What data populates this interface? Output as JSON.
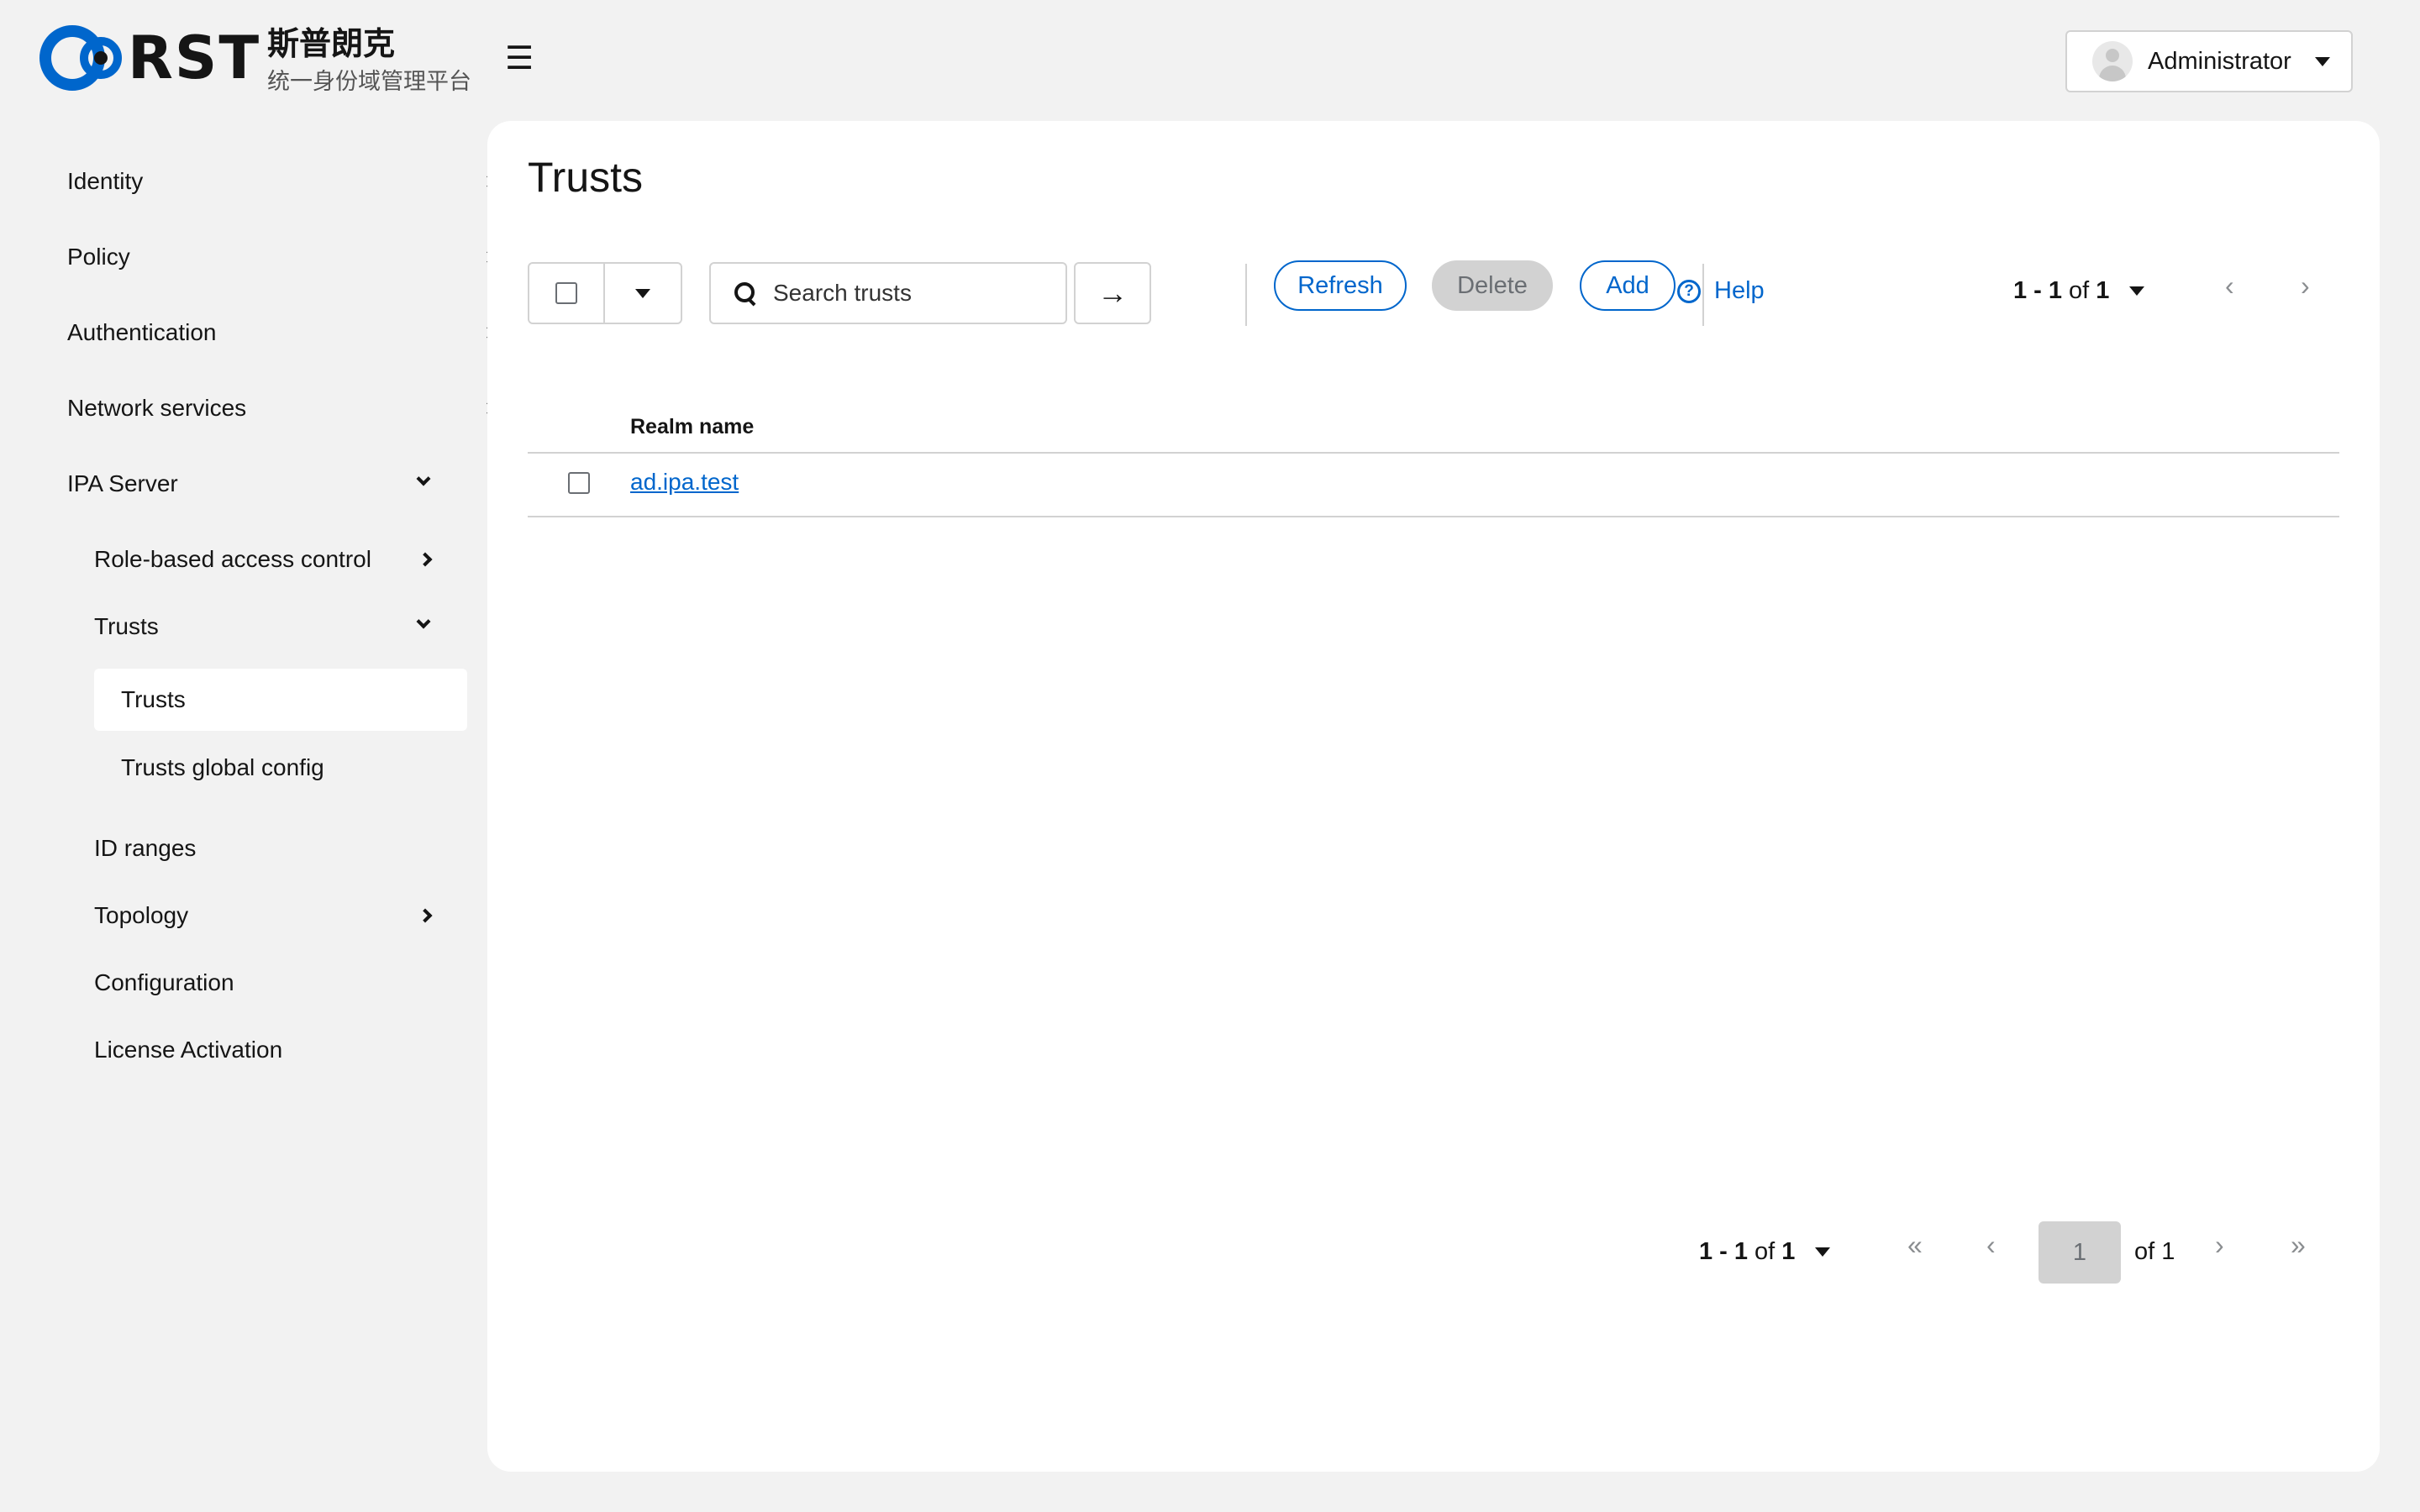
{
  "brand": {
    "logo_text": "RST",
    "cn_title": "斯普朗克",
    "cn_subtitle": "统一身份域管理平台",
    "accent": "#0066cc"
  },
  "header": {
    "menu_icon": "hamburger-icon",
    "user_name": "Administrator"
  },
  "sidebar": {
    "items": [
      {
        "label": "Identity",
        "expanded": false
      },
      {
        "label": "Policy",
        "expanded": false
      },
      {
        "label": "Authentication",
        "expanded": false
      },
      {
        "label": "Network services",
        "expanded": false
      },
      {
        "label": "IPA Server",
        "expanded": true
      },
      {
        "label": "Role-based access control",
        "expanded": false
      },
      {
        "label": "Trusts",
        "expanded": true
      },
      {
        "label": "Trusts",
        "active": true
      },
      {
        "label": "Trusts global config"
      },
      {
        "label": "ID ranges"
      },
      {
        "label": "Topology",
        "expanded": false
      },
      {
        "label": "Configuration"
      },
      {
        "label": "License Activation"
      }
    ]
  },
  "main": {
    "title": "Trusts",
    "search_placeholder": "Search trusts",
    "buttons": {
      "refresh": "Refresh",
      "delete": "Delete",
      "add": "Add",
      "help": "Help"
    },
    "pager_top": {
      "range": "1 - 1",
      "of_label": "of",
      "total": "1"
    },
    "table": {
      "columns": [
        "Realm name"
      ],
      "rows": [
        {
          "realm_name": "ad.ipa.test"
        }
      ]
    },
    "pager_bottom": {
      "range": "1 - 1",
      "of_label": "of",
      "total": "1",
      "current_page": "1",
      "page_of": "of 1"
    }
  },
  "colors": {
    "background": "#f2f2f2",
    "link": "#0066cc",
    "border": "#d2d2d2",
    "disabled": "#d2d2d2"
  }
}
